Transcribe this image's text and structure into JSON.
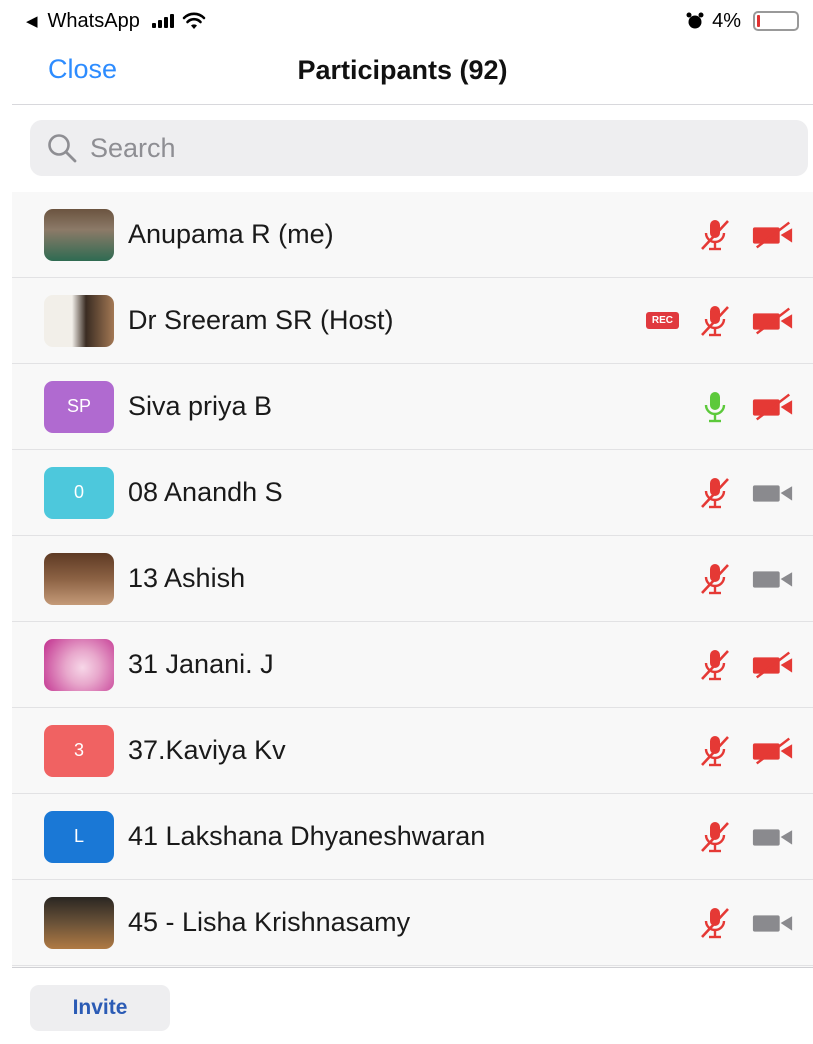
{
  "status_bar": {
    "back_label": "WhatsApp",
    "battery_text": "4%"
  },
  "nav": {
    "close_label": "Close",
    "title": "Participants (92)"
  },
  "search": {
    "placeholder": "Search",
    "value": ""
  },
  "participants": [
    {
      "name": "Anupama R (me)",
      "avatar": "photo",
      "initials": "",
      "avatar_color": "#6b5440",
      "rec": false,
      "mic": "muted",
      "video": "off"
    },
    {
      "name": "Dr Sreeram SR (Host)",
      "avatar": "photo",
      "initials": "",
      "avatar_color": "#3a2c22",
      "rec": true,
      "rec_label": "REC",
      "mic": "muted",
      "video": "off"
    },
    {
      "name": "Siva priya B",
      "avatar": "initials",
      "initials": "SP",
      "avatar_color": "#b06ad0",
      "rec": false,
      "mic": "on",
      "video": "off"
    },
    {
      "name": "08 Anandh S",
      "avatar": "initials",
      "initials": "0",
      "avatar_color": "#4dc8dc",
      "rec": false,
      "mic": "muted",
      "video": "available"
    },
    {
      "name": "13 Ashish",
      "avatar": "photo",
      "initials": "",
      "avatar_color": "#8c6244",
      "rec": false,
      "mic": "muted",
      "video": "available"
    },
    {
      "name": "31 Janani. J",
      "avatar": "photo",
      "initials": "",
      "avatar_color": "#c12e8e",
      "rec": false,
      "mic": "muted",
      "video": "off"
    },
    {
      "name": "37.Kaviya Kv",
      "avatar": "initials",
      "initials": "3",
      "avatar_color": "#f06262",
      "rec": false,
      "mic": "muted",
      "video": "off"
    },
    {
      "name": "41 Lakshana Dhyaneshwaran",
      "avatar": "initials",
      "initials": "L",
      "avatar_color": "#1a78d6",
      "rec": false,
      "mic": "muted",
      "video": "available"
    },
    {
      "name": "45 - Lisha Krishnasamy",
      "avatar": "photo",
      "initials": "",
      "avatar_color": "#6a5238",
      "rec": false,
      "mic": "muted",
      "video": "available"
    }
  ],
  "footer": {
    "invite_label": "Invite"
  },
  "colors": {
    "accent": "#2d8cff",
    "muted_red": "#e53935",
    "mic_on_green": "#5cc93b",
    "video_gray": "#8a8a8e",
    "rec_red": "#e0393e"
  }
}
